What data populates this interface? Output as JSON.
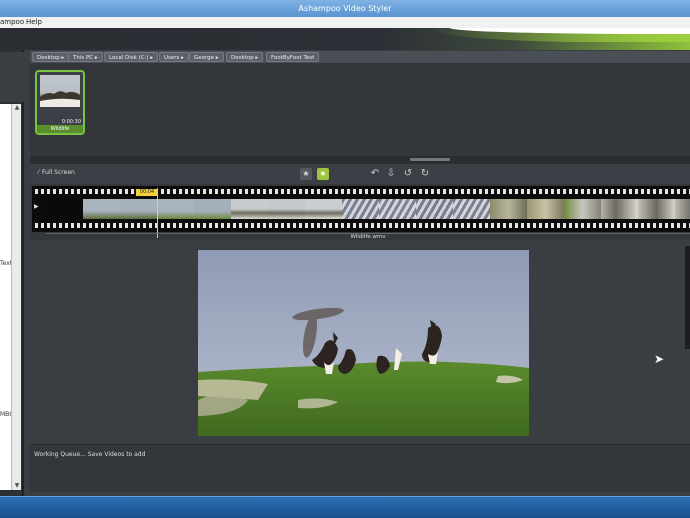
{
  "window": {
    "title": "Ashampoo Video Styler"
  },
  "menu": {
    "items": [
      "ampoo",
      "Help"
    ]
  },
  "left_panel": {
    "text_a": "Text",
    "text_b": "MBO"
  },
  "breadcrumb": {
    "items": [
      "Desktop",
      "This PC",
      "Local Disk (C:)",
      "Users",
      "George",
      "Desktop",
      "FootByFoot Test"
    ]
  },
  "media": {
    "clip": {
      "label": "Wildlife",
      "duration": "0:00:30"
    }
  },
  "timeline_toolbar": {
    "fullscreen_label": "Full Screen",
    "star_icon": "star-icon",
    "active_icon": "star-filled-icon"
  },
  "timeline": {
    "playhead_time": "00:04",
    "filename": "Wildlife.wmv",
    "accent_color": "#f1d23a"
  },
  "status": {
    "text": "Working Queue... Save Videos to add"
  },
  "colors": {
    "accent_green": "#9dc43d",
    "taskbar": "#1b4f8e"
  }
}
